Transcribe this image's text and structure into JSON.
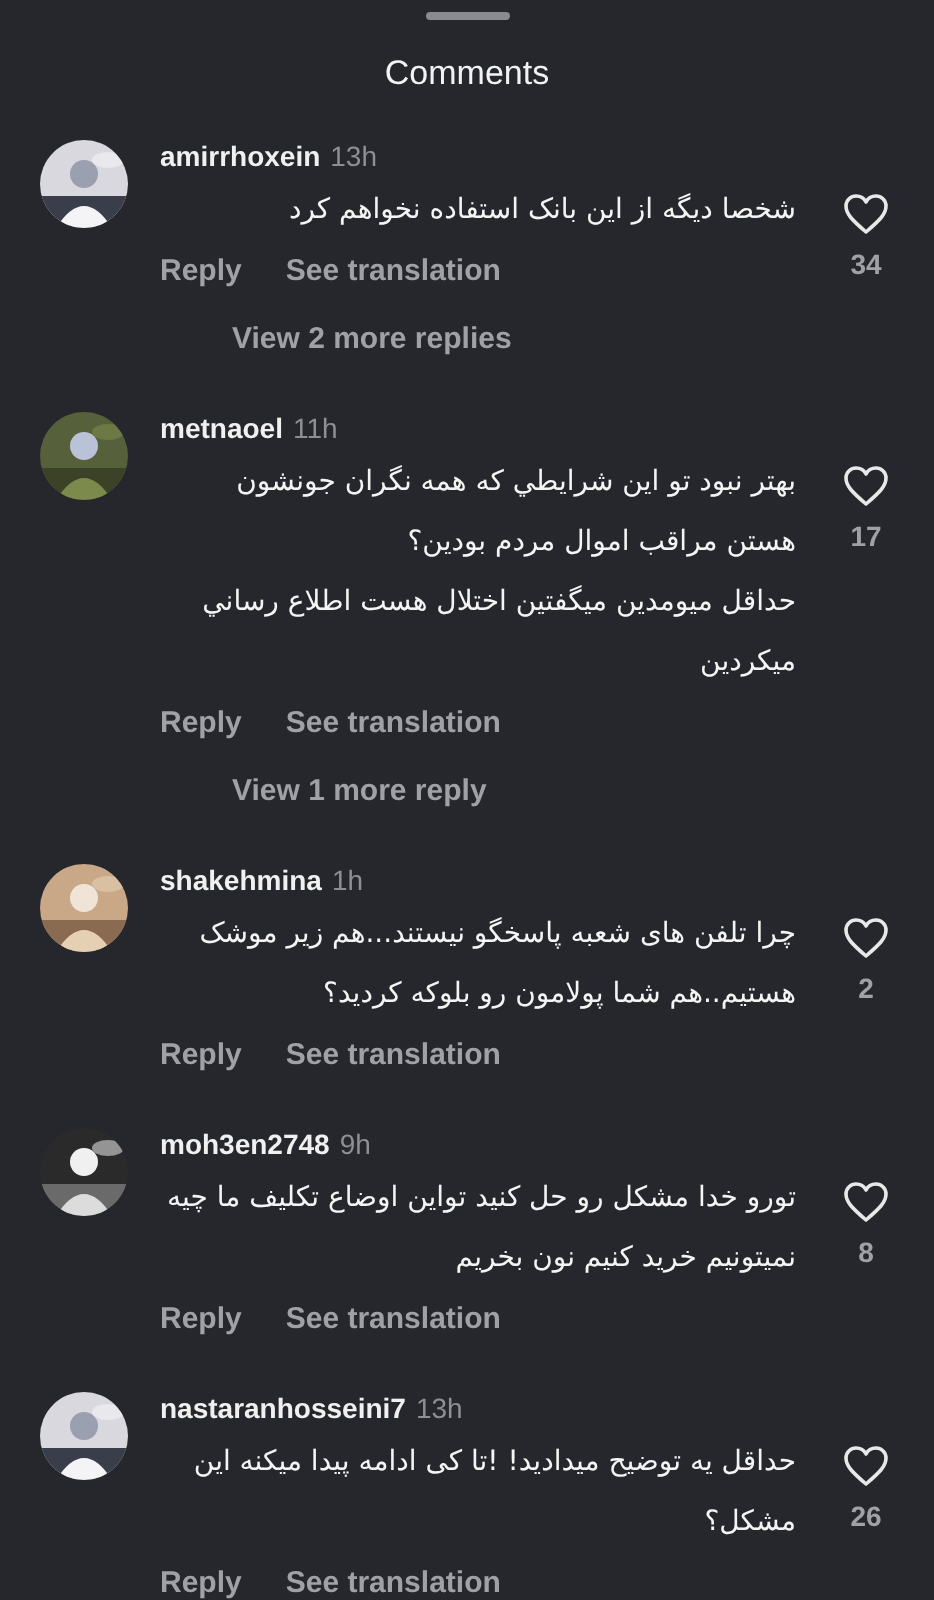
{
  "header": {
    "title": "Comments"
  },
  "comments": [
    {
      "username": "amirrhoxein",
      "time": "13h",
      "body": [
        "شخصا دیگه از این بانک استفاده نخواهم کرد"
      ],
      "likes": "34",
      "reply": "Reply",
      "translate": "See translation",
      "more_replies": "View 2 more replies"
    },
    {
      "username": "metnaoel",
      "time": "11h",
      "body": [
        "بهتر نبود تو این شرايطي که همه نگران جونشون هستن مراقب اموال مردم بودین؟",
        "حداقل میومدین میگفتین اختلال هست اطلاع رساني میکردین"
      ],
      "likes": "17",
      "reply": "Reply",
      "translate": "See translation",
      "more_replies": "View 1 more reply"
    },
    {
      "username": "shakehmina",
      "time": "1h",
      "body": [
        "چرا تلفن های شعبه پاسخگو نیستند...هم زیر موشک هستیم..هم شما پولامون رو بلوکه کردید؟"
      ],
      "likes": "2",
      "reply": "Reply",
      "translate": "See translation"
    },
    {
      "username": "moh3en2748",
      "time": "9h",
      "body": [
        "تورو خدا مشکل رو حل کنید تواین اوضاع تکلیف ما چیه نمیتونیم خرید کنیم نون بخریم"
      ],
      "likes": "8",
      "reply": "Reply",
      "translate": "See translation"
    },
    {
      "username": "nastaranhosseini7",
      "time": "13h",
      "body": [
        "حداقل یه توضیح میدادید! !تا کی ادامه پیدا میکنه این مشکل؟"
      ],
      "likes": "26",
      "reply": "Reply",
      "translate": "See translation"
    }
  ]
}
